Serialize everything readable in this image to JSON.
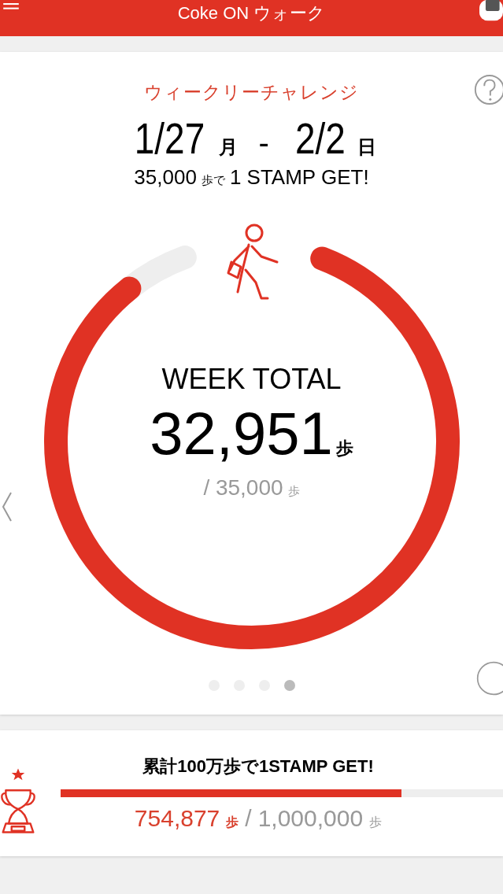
{
  "header": {
    "title": "Coke ON ウォーク"
  },
  "challenge": {
    "title": "ウィークリーチャレンジ",
    "start_date": "1/27",
    "start_day": "月",
    "separator": "-",
    "end_date": "2/2",
    "end_day": "日",
    "goal_steps": "35,000",
    "goal_unit": "歩で",
    "goal_reward": "1 STAMP GET!"
  },
  "ring": {
    "label": "WEEK TOTAL",
    "value": "32,951",
    "unit": "歩",
    "target": "/ 35,000",
    "target_unit": "歩"
  },
  "pager": [
    {
      "selected": false
    },
    {
      "selected": false
    },
    {
      "selected": false
    },
    {
      "selected": true
    }
  ],
  "cumulative": {
    "title": "累計100万歩で1STAMP GET!",
    "level": 0.77,
    "current": "754,877",
    "current_unit": "歩",
    "separator": "/",
    "total": "1,000,000",
    "total_unit": "歩"
  }
}
